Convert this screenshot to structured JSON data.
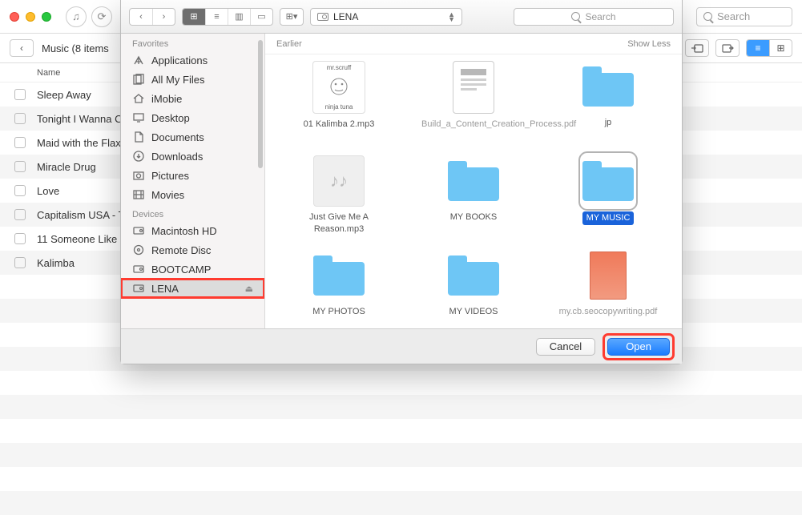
{
  "main_toolbar": {
    "search_placeholder": "Search"
  },
  "breadcrumb": "Music (8 items",
  "columns": {
    "name": "Name"
  },
  "songs": [
    {
      "name": "Sleep Away"
    },
    {
      "name": "Tonight I Wanna C"
    },
    {
      "name": "Maid with the Flax"
    },
    {
      "name": "Miracle Drug"
    },
    {
      "name": "Love"
    },
    {
      "name": "Capitalism USA - T"
    },
    {
      "name": "11 Someone Like"
    },
    {
      "name": "Kalimba"
    }
  ],
  "dialog": {
    "location": "LENA",
    "search_placeholder": "Search",
    "section_label": "Earlier",
    "showless": "Show Less",
    "sidebar": {
      "favorites_label": "Favorites",
      "devices_label": "Devices",
      "favorites": [
        {
          "label": "Applications",
          "icon": "apps"
        },
        {
          "label": "All My Files",
          "icon": "allfiles"
        },
        {
          "label": "iMobie",
          "icon": "home"
        },
        {
          "label": "Desktop",
          "icon": "desktop"
        },
        {
          "label": "Documents",
          "icon": "documents"
        },
        {
          "label": "Downloads",
          "icon": "downloads"
        },
        {
          "label": "Pictures",
          "icon": "pictures"
        },
        {
          "label": "Movies",
          "icon": "movies"
        }
      ],
      "devices": [
        {
          "label": "Macintosh HD",
          "icon": "disk",
          "ejectable": false
        },
        {
          "label": "Remote Disc",
          "icon": "remote",
          "ejectable": false
        },
        {
          "label": "BOOTCAMP",
          "icon": "disk",
          "ejectable": false
        },
        {
          "label": "LENA",
          "icon": "disk",
          "ejectable": true,
          "selected": true,
          "highlighted": true
        }
      ]
    },
    "grid": [
      {
        "label": "01 Kalimba 2.mp3",
        "kind": "image",
        "thumb_text_top": "mr.scruff",
        "thumb_text_bot": "ninja tuna"
      },
      {
        "label": "Build_a_Content_Creation_Process.pdf",
        "kind": "pdf",
        "dim": true
      },
      {
        "label": "jp",
        "kind": "folder"
      },
      {
        "label": "Just Give Me A Reason.mp3",
        "kind": "audio"
      },
      {
        "label": "MY BOOKS",
        "kind": "folder"
      },
      {
        "label": "MY MUSIC",
        "kind": "folder",
        "selected": true
      },
      {
        "label": "MY PHOTOS",
        "kind": "folder"
      },
      {
        "label": "MY VIDEOS",
        "kind": "folder"
      },
      {
        "label": "my.cb.seocopywriting.pdf",
        "kind": "booklet",
        "dim": true
      }
    ],
    "buttons": {
      "cancel": "Cancel",
      "open": "Open"
    }
  }
}
